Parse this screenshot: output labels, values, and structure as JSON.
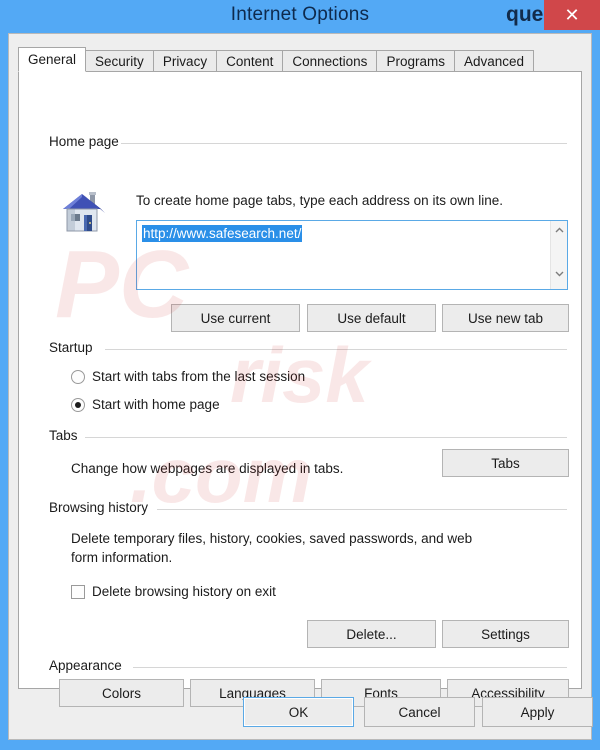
{
  "window": {
    "title": "Internet Options",
    "help_icon": "question-mark-icon",
    "close_icon": "✕",
    "titlebar_color": "#53a9f5",
    "close_button_color": "#d0474a"
  },
  "tabs": [
    {
      "label": "General",
      "active": true
    },
    {
      "label": "Security",
      "active": false
    },
    {
      "label": "Privacy",
      "active": false
    },
    {
      "label": "Content",
      "active": false
    },
    {
      "label": "Connections",
      "active": false
    },
    {
      "label": "Programs",
      "active": false
    },
    {
      "label": "Advanced",
      "active": false
    }
  ],
  "home_page": {
    "group_label": "Home page",
    "icon": "house-icon",
    "description": "To create home page tabs, type each address on its own line.",
    "address_value": "http://www.safesearch.net/",
    "address_selected": true,
    "selection_color": "#2a8fe8",
    "scroll_up_icon": "chevron-up-icon",
    "scroll_down_icon": "chevron-down-icon",
    "buttons": [
      {
        "label": "Use current"
      },
      {
        "label": "Use default"
      },
      {
        "label": "Use new tab"
      }
    ]
  },
  "startup": {
    "group_label": "Startup",
    "options": [
      {
        "label": "Start with tabs from the last session",
        "selected": false
      },
      {
        "label": "Start with home page",
        "selected": true
      }
    ]
  },
  "tabs_section": {
    "group_label": "Tabs",
    "description": "Change how webpages are displayed in tabs.",
    "button_label": "Tabs"
  },
  "browsing_history": {
    "group_label": "Browsing history",
    "description_line1": "Delete temporary files, history, cookies, saved passwords, and web",
    "description_line2": "form information.",
    "checkbox_label": "Delete browsing history on exit",
    "checkbox_checked": false,
    "buttons": [
      {
        "label": "Delete..."
      },
      {
        "label": "Settings"
      }
    ]
  },
  "appearance": {
    "group_label": "Appearance",
    "buttons": [
      {
        "label": "Colors"
      },
      {
        "label": "Languages"
      },
      {
        "label": "Fonts"
      },
      {
        "label": "Accessibility"
      }
    ]
  },
  "footer": {
    "ok_label": "OK",
    "cancel_label": "Cancel",
    "apply_label": "Apply"
  },
  "watermark": {
    "line1": "PC",
    "line2": "risk",
    "line3": ".com"
  }
}
